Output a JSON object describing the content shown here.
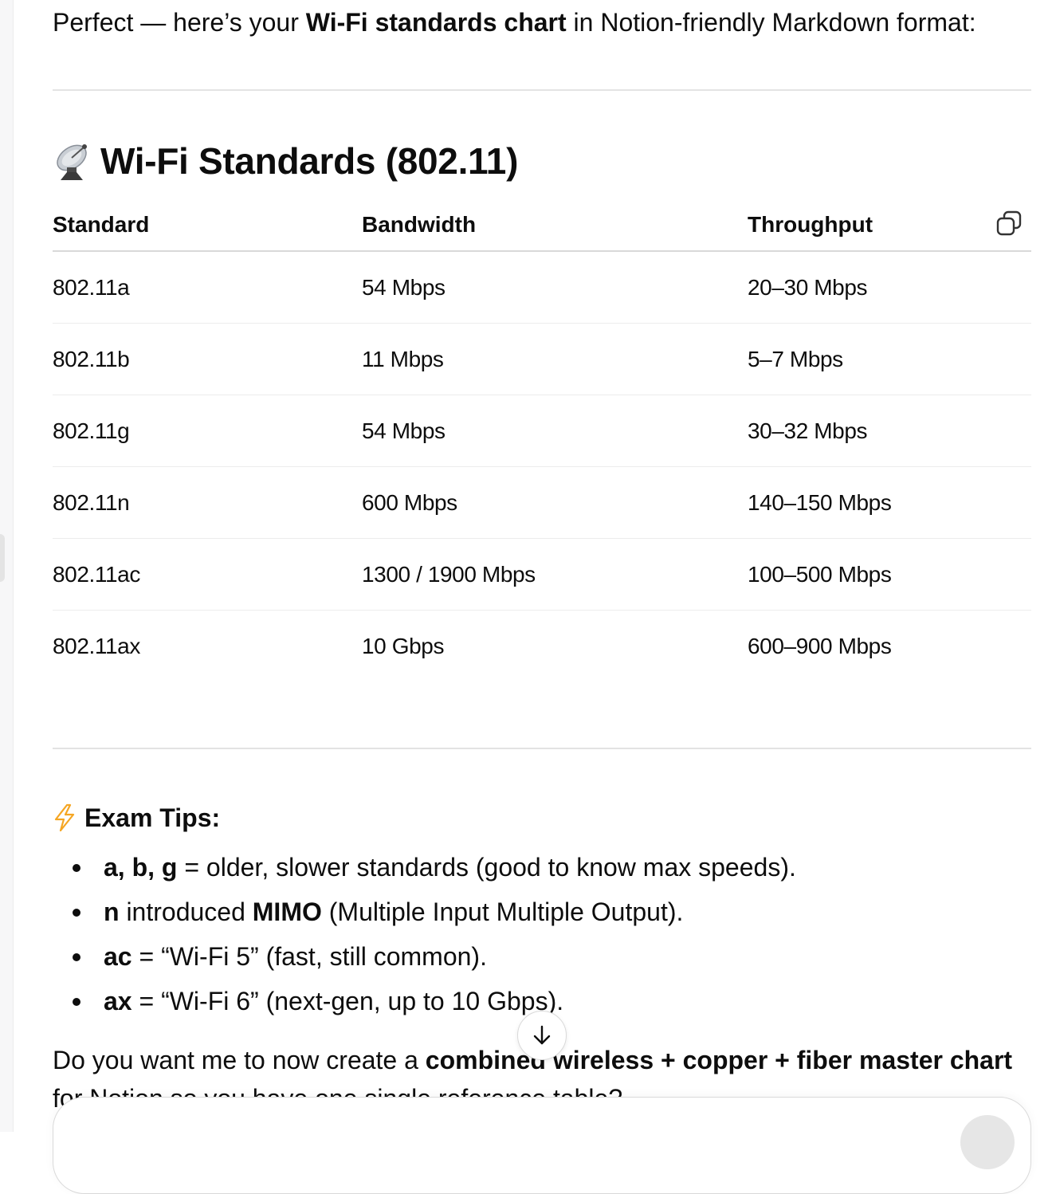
{
  "message": {
    "intro": {
      "prefix": "Perfect — here’s your ",
      "bold": "Wi-Fi standards chart",
      "suffix": " in Notion-friendly Markdown format:"
    },
    "heading": {
      "emoji_icon": "satellite-antenna-icon",
      "title": "Wi-Fi Standards (802.11)"
    },
    "table": {
      "headers": [
        "Standard",
        "Bandwidth",
        "Throughput"
      ],
      "rows": [
        [
          "802.11a",
          "54 Mbps",
          "20–30 Mbps"
        ],
        [
          "802.11b",
          "11 Mbps",
          "5–7 Mbps"
        ],
        [
          "802.11g",
          "54 Mbps",
          "30–32 Mbps"
        ],
        [
          "802.11n",
          "600 Mbps",
          "140–150 Mbps"
        ],
        [
          "802.11ac",
          "1300 / 1900 Mbps",
          "100–500 Mbps"
        ],
        [
          "802.11ax",
          "10 Gbps",
          "600–900 Mbps"
        ]
      ],
      "copy_icon": "copy-icon"
    },
    "tips": {
      "icon": "lightning-icon",
      "title": "Exam Tips:",
      "items": [
        {
          "bold": "a, b, g",
          "text": " = older, slower standards (good to know max speeds)."
        },
        {
          "bold": "n",
          "text": " introduced ",
          "bold2": "MIMO",
          "text2": " (Multiple Input Multiple Output)."
        },
        {
          "bold": "ac",
          "text": " = “Wi-Fi 5” (fast, still common)."
        },
        {
          "bold": "ax",
          "text": " = “Wi-Fi 6” (next-gen, up to 10 Gbps)."
        }
      ]
    },
    "closing": {
      "prefix": "Do you want me to now create a ",
      "bold": "combined wireless + copper + fiber master chart",
      "suffix": " for Notion so you have one single reference table?"
    }
  },
  "controls": {
    "scroll_down_icon": "arrow-down-icon"
  },
  "colors": {
    "text": "#0d0d0d",
    "divider": "#e3e3e3",
    "bolt": "#f5a623"
  }
}
